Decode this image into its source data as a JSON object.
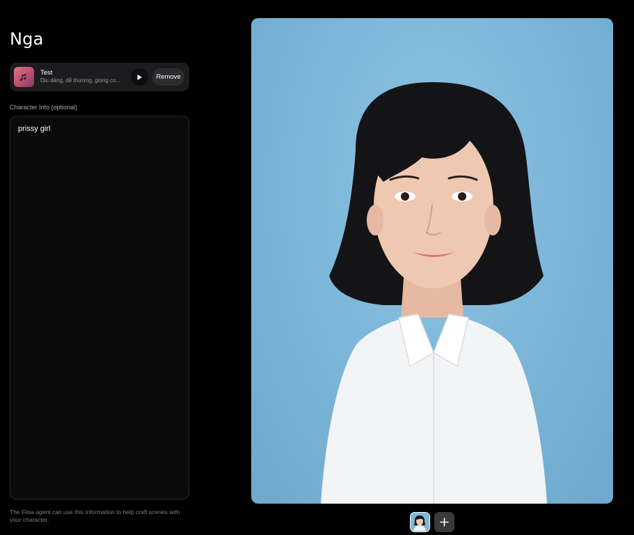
{
  "character": {
    "name": "Nga"
  },
  "voice": {
    "name": "Test",
    "description": "Dịu dàng, dễ thương, giọng co...",
    "play_icon": "play-icon",
    "remove_label": "Remove"
  },
  "info": {
    "label": "Character Info (optional)",
    "value": "prissy girl",
    "helper": "The Flow agent can use this information to help craft scenes with your character."
  },
  "gallery": {
    "add_icon": "plus-icon"
  },
  "colors": {
    "background": "#000000",
    "card": "#1c1c1e",
    "portrait_bg": "#7db7d9",
    "thumb_gradient_start": "#e8707f",
    "thumb_gradient_end": "#7f3a6a"
  }
}
